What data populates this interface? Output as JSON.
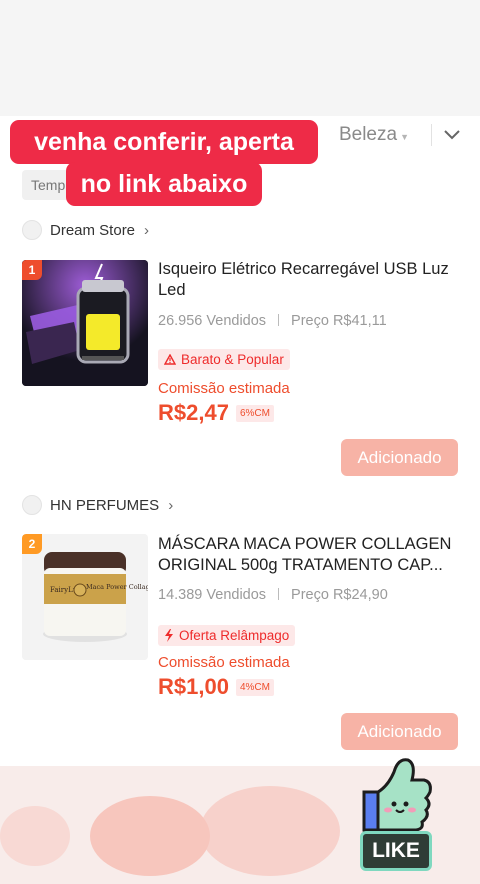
{
  "tabs": {
    "category": "Beleza"
  },
  "overlay": {
    "line1": "venha conferir, aperta",
    "line2": "no link abaixo"
  },
  "filter_chip": "Temp",
  "products": [
    {
      "store": "Dream Store",
      "rank": "1",
      "title": "Isqueiro Elétrico Recarregável USB Luz Led",
      "sold": "26.956 Vendidos",
      "price": "Preço R$41,11",
      "badge": "Barato & Popular",
      "badge_icon": "warning-triangle-icon",
      "commission_label": "Comissão estimada",
      "commission_value": "R$2,47",
      "commission_pct": "6%CM",
      "button": "Adicionado"
    },
    {
      "store": "HN PERFUMES",
      "rank": "2",
      "title": "MÁSCARA MACA POWER COLLAGEN ORIGINAL 500g TRATAMENTO CAP...",
      "sold": "14.389 Vendidos",
      "price": "Preço R$24,90",
      "badge": "Oferta Relâmpago",
      "badge_icon": "lightning-icon",
      "commission_label": "Comissão estimada",
      "commission_value": "R$1,00",
      "commission_pct": "4%CM",
      "button": "Adicionado",
      "jar_brand": "FairyLu",
      "jar_text": "Maca Power Collagen"
    }
  ],
  "sticker": {
    "label": "LIKE"
  },
  "colors": {
    "accent": "#ee4d2d",
    "overlay": "#ee2b47",
    "button": "#f7b3a6"
  }
}
